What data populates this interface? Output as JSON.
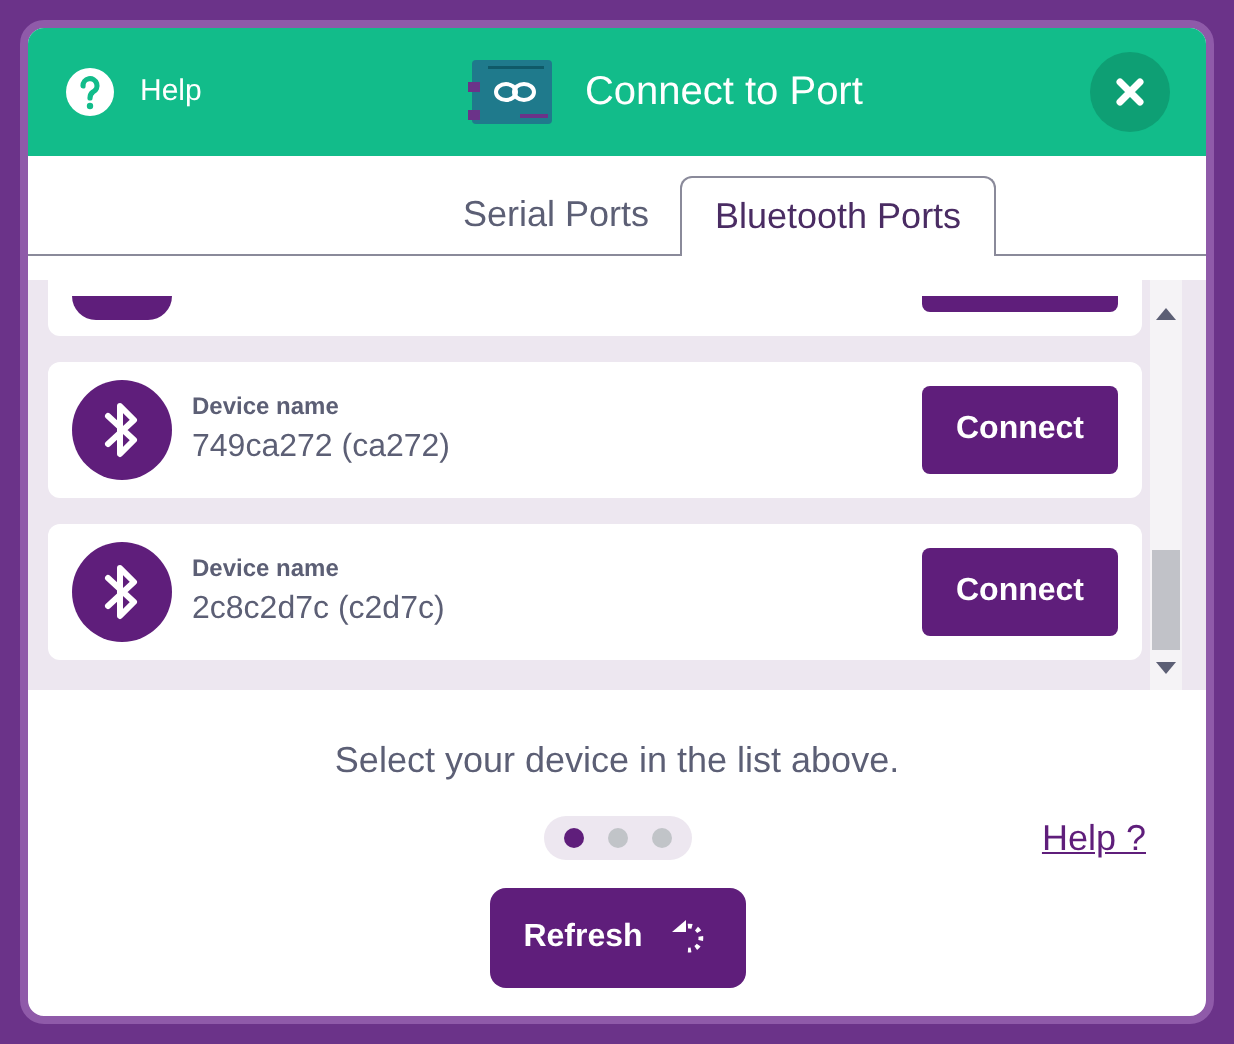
{
  "header": {
    "help": "Help",
    "title": "Connect to Port"
  },
  "tabs": [
    {
      "label": "Serial Ports",
      "selected": false
    },
    {
      "label": "Bluetooth Ports",
      "selected": true
    }
  ],
  "devices": [
    {
      "caption": "Device name",
      "name": "749ca272 (ca272)",
      "button": "Connect"
    },
    {
      "caption": "Device name",
      "name": "2c8c2d7c (c2d7c)",
      "button": "Connect"
    }
  ],
  "hint": "Select your device in the list above.",
  "pager": [
    {
      "selected": true
    },
    {
      "selected": false
    },
    {
      "selected": false
    }
  ],
  "help_link": "Help ?",
  "refresh": "Refresh"
}
